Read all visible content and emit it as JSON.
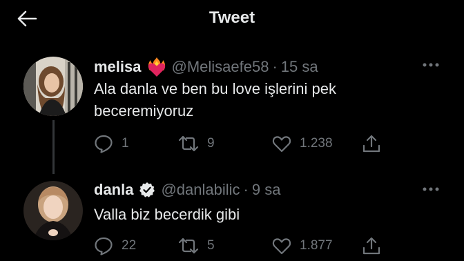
{
  "header": {
    "title": "Tweet",
    "back_icon": "arrow-left-icon"
  },
  "tweets": [
    {
      "name": "melisa",
      "name_emoji": "heart-on-fire-icon",
      "handle": "@Melisaefe58",
      "separator": "·",
      "time": "15 sa",
      "text": "Ala danla ve ben bu love işlerini pek beceremiyoruz",
      "replies": "1",
      "retweets": "9",
      "likes": "1.238"
    },
    {
      "name": "danla",
      "verified_icon": "verified-badge-icon",
      "handle": "@danlabilic",
      "separator": "·",
      "time": "9 sa",
      "text": "Valla biz becerdik gibi",
      "replies": "22",
      "retweets": "5",
      "likes": "1.877"
    }
  ],
  "colors": {
    "background": "#000000",
    "text": "#e7e9ea",
    "secondary": "#71767b",
    "thread_line": "#333639",
    "heart_fire": "#e0245e"
  }
}
